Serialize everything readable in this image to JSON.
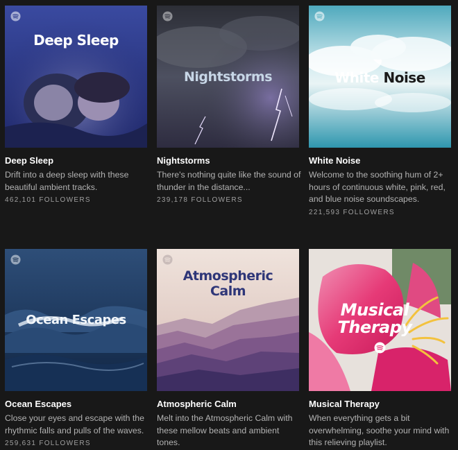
{
  "playlists": [
    {
      "cover_title": "Deep Sleep",
      "name": "Deep Sleep",
      "description": "Drift into a deep sleep with these beautiful ambient tracks.",
      "followers": "462,101 FOLLOWERS",
      "colors": {
        "bg": "#2b3a8a",
        "accent": "#5a6ed0"
      }
    },
    {
      "cover_title": "Nightstorms",
      "name": "Nightstorms",
      "description": "There's nothing quite like the sound of thunder in the distance...",
      "followers": "239,178 FOLLOWERS",
      "colors": {
        "bg": "#3a3c48",
        "accent": "#b9a6e0"
      }
    },
    {
      "cover_title_a": "White",
      "cover_title_b": "Noise",
      "name": "White Noise",
      "description": "Welcome to the soothing hum of 2+ hours of continuous white, pink, red, and blue noise soundscapes.",
      "followers": "221,593 FOLLOWERS",
      "colors": {
        "bg": "#5fb3c4",
        "accent": "#eaf6f8"
      }
    },
    {
      "cover_title": "Ocean Escapes",
      "name": "Ocean Escapes",
      "description": "Close your eyes and escape with the rhythmic falls and pulls of the waves.",
      "followers": "259,631 FOLLOWERS",
      "colors": {
        "bg": "#1c3556",
        "accent": "#d6e2ee"
      }
    },
    {
      "cover_title_line1": "Atmospheric",
      "cover_title_line2": "Calm",
      "name": "Atmospheric Calm",
      "description": "Melt into the Atmospheric Calm with these mellow beats and ambient tones.",
      "colors": {
        "bg": "#e9d8cf",
        "accent": "#2e3678"
      }
    },
    {
      "cover_title_line1": "Musical",
      "cover_title_line2": "Therapy",
      "name": "Musical Therapy",
      "description": "When everything gets a bit overwhelming, soothe your mind with this relieving playlist.",
      "colors": {
        "bg": "#e93a78",
        "accent": "#f3c23e"
      }
    }
  ],
  "icons": {
    "brand": "spotify-icon"
  }
}
